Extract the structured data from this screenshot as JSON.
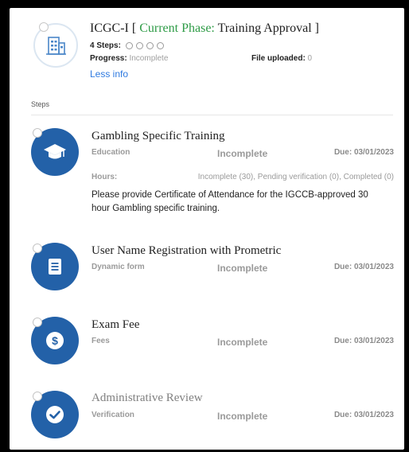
{
  "header": {
    "title_prefix": "ICGC-I [ ",
    "phase_label": "Current Phase: ",
    "phase_value": "Training Approval",
    "title_suffix": " ]",
    "steps_label": "4 Steps:",
    "progress_label": "Progress:",
    "progress_value": " Incomplete",
    "file_label": "File uploaded:",
    "file_value": " 0",
    "less_info": "Less info",
    "icon": "building-icon"
  },
  "steps_section_label": "Steps",
  "steps": [
    {
      "title": "Gambling Specific Training",
      "type": "Education",
      "status": "Incomplete",
      "due": "Due: 03/01/2023",
      "icon": "graduation-cap-icon",
      "hours_label": "Hours:",
      "hours_value": "Incomplete (30), Pending verification (0), Completed (0)",
      "description": "Please provide Certificate of Attendance for the IGCCB-approved 30 hour Gambling specific training."
    },
    {
      "title": "User Name Registration with Prometric",
      "type": "Dynamic form",
      "status": "Incomplete",
      "due": "Due: 03/01/2023",
      "icon": "form-icon"
    },
    {
      "title": "Exam Fee",
      "type": "Fees",
      "status": "Incomplete",
      "due": "Due: 03/01/2023",
      "icon": "dollar-icon"
    },
    {
      "title": "Administrative Review",
      "type": "Verification",
      "status": "Incomplete",
      "due": "Due: 03/01/2023",
      "icon": "check-icon"
    }
  ],
  "colors": {
    "step_circle": "#2361a8",
    "phase_green": "#2e9b46",
    "link_blue": "#2f7ae0"
  }
}
